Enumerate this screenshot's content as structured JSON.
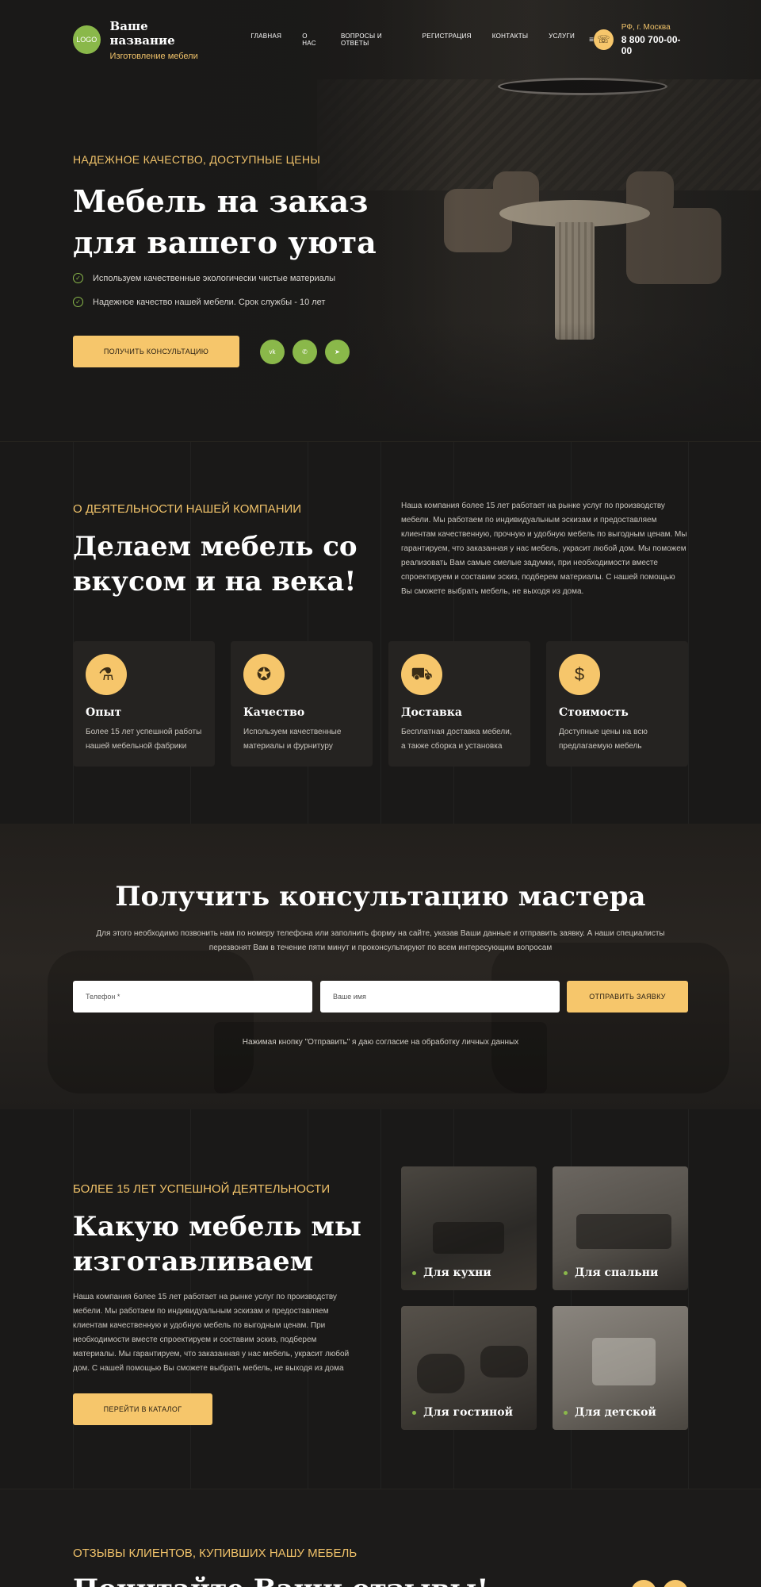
{
  "header": {
    "logo": "LOGO",
    "brand_name": "Ваше название",
    "brand_sub": "Изготовление мебели",
    "nav": [
      "Главная",
      "О нас",
      "Вопросы и ответы",
      "Регистрация",
      "Контакты",
      "Услуги"
    ],
    "menu_icon": "≡",
    "city": "РФ, г. Москва",
    "phone": "8 800 700-00-00"
  },
  "hero": {
    "eyebrow": "НАДЕЖНОЕ КАЧЕСТВО, ДОСТУПНЫЕ ЦЕНЫ",
    "title": "Мебель на заказ для вашего уюта",
    "checks": [
      "Используем качественные экологически чистые материалы",
      "Надежное  качество нашей мебели. Срок службы - 10 лет"
    ],
    "button": "ПОЛУЧИТЬ КОНСУЛЬТАЦИЮ",
    "socials": [
      "vk",
      "whatsapp",
      "telegram"
    ]
  },
  "about": {
    "eyebrow": "О ДЕЯТЕЛЬНОСТИ НАШЕЙ КОМПАНИИ",
    "title": "Делаем мебель со вкусом и на века!",
    "text": "Наша компания более 15 лет работает на рынке услуг по производству мебели. Мы работаем по индивидуальным эскизам и предоставляем клиентам качественную, прочную и удобную мебель по выгодным ценам. Мы гарантируем, что заказанная у нас мебель, украсит любой дом. Мы поможем реализовать Вам самые смелые задумки, при необходимости вместе спроектируем и составим эскиз,  подберем материалы. С нашей помощью Вы сможете выбрать мебель, не выходя из дома.",
    "cards": [
      {
        "icon": "vacuum-icon",
        "title": "Опыт",
        "text": "Более 15 лет успешной работы нашей мебельной фабрики"
      },
      {
        "icon": "medal-icon",
        "title": "Качество",
        "text": "Используем качественные материалы и фурнитуру"
      },
      {
        "icon": "delivery-truck-icon",
        "title": "Доставка",
        "text": "Бесплатная доставка мебели, а также сборка и установка"
      },
      {
        "icon": "money-bag-icon",
        "title": "Стоимость",
        "text": "Доступные цены на всю предлагаемую мебель"
      }
    ]
  },
  "consult": {
    "title": "Получить консультацию мастера",
    "text": "Для этого необходимо позвонить нам по номеру телефона или заполнить форму на сайте, указав Ваши данные и отправить заявку. А наши специалисты перезвонят Вам в течение пяти минут и проконсультируют по всем интересующим вопросам",
    "phone_placeholder": "Телефон *",
    "name_placeholder": "Ваше имя",
    "button": "ОТПРАВИТЬ ЗАЯВКУ",
    "consent": "Нажимая кнопку \"Отправить\" я даю согласие на обработку личных данных"
  },
  "catalog": {
    "eyebrow": "БОЛЕЕ 15 ЛЕТ УСПЕШНОЙ ДЕЯТЕЛЬНОСТИ",
    "title": "Какую мебель мы изготавливаем",
    "text": "Наша компания более 15 лет работает на рынке услуг по производству мебели. Мы работаем по индивидуальным эскизам и предоставляем клиентам качественную и удобную мебель по выгодным ценам. При необходимости вместе спроектируем и составим эскиз,  подберем материалы. Мы гарантируем, что заказанная у нас мебель, украсит любой дом. С нашей помощью Вы сможете выбрать мебель, не выходя из дома",
    "button": "ПЕРЕЙТИ В КАТАЛОГ",
    "tiles": [
      "Для кухни",
      "Для спальни",
      "Для гостиной",
      "Для детской"
    ]
  },
  "reviews": {
    "eyebrow": "ОТЗЫВЫ КЛИЕНТОВ, КУПИВШИХ НАШУ МЕБЕЛЬ",
    "title": "Почитайте Ваши отзывы!"
  },
  "colors": {
    "background": "#1a1918",
    "accent": "#f1c36a",
    "button": "#f6c66b",
    "green": "#8ab84a"
  }
}
